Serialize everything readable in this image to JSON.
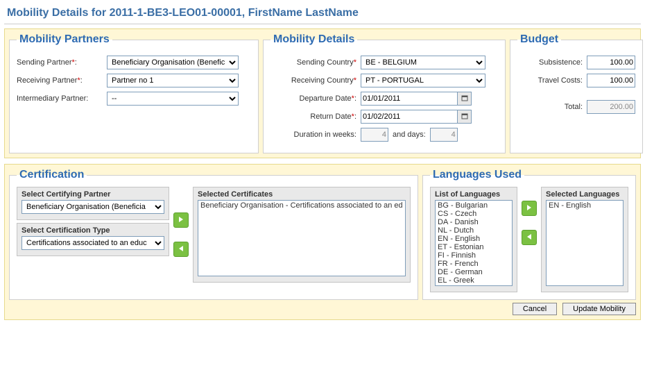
{
  "title": "Mobility Details for 2011-1-BE3-LEO01-00001, FirstName LastName",
  "partners": {
    "legend": "Mobility Partners",
    "sending_label": "Sending Partner",
    "receiving_label": "Receiving Partner",
    "intermediary_label": "Intermediary Partner:",
    "sending_value": "Beneficiary Organisation (Benefici",
    "receiving_value": "Partner no 1",
    "intermediary_value": "--"
  },
  "details": {
    "legend": "Mobility Details",
    "sending_country_label": "Sending Country",
    "receiving_country_label": "Receiving Country",
    "departure_label": "Departure Date",
    "return_label": "Return Date",
    "duration_label": "Duration in weeks:",
    "duration_days_label": "and days:",
    "sending_country": "BE - BELGIUM",
    "receiving_country": "PT - PORTUGAL",
    "departure_date": "01/01/2011",
    "return_date": "01/02/2011",
    "duration_weeks": "4",
    "duration_days": "4"
  },
  "budget": {
    "legend": "Budget",
    "subsistence_label": "Subsistence:",
    "travel_label": "Travel Costs:",
    "total_label": "Total:",
    "subsistence": "100.00",
    "travel": "100.00",
    "total": "200.00"
  },
  "cert": {
    "legend": "Certification",
    "partner_label": "Select Certifying Partner",
    "type_label": "Select Certification Type",
    "selected_label": "Selected Certificates",
    "partner_value": "Beneficiary Organisation (Beneficia",
    "type_value": "Certifications associated to an educ",
    "selected_item": "Beneficiary Organisation - Certifications associated to an ed"
  },
  "lang": {
    "legend": "Languages Used",
    "list_label": "List of Languages",
    "selected_label": "Selected Languages",
    "available": [
      "BG - Bulgarian",
      "CS - Czech",
      "DA - Danish",
      "NL - Dutch",
      "EN - English",
      "ET - Estonian",
      "FI - Finnish",
      "FR - French",
      "DE - German",
      "EL - Greek"
    ],
    "selected": [
      "EN - English"
    ]
  },
  "buttons": {
    "cancel": "Cancel",
    "update": "Update Mobility"
  }
}
